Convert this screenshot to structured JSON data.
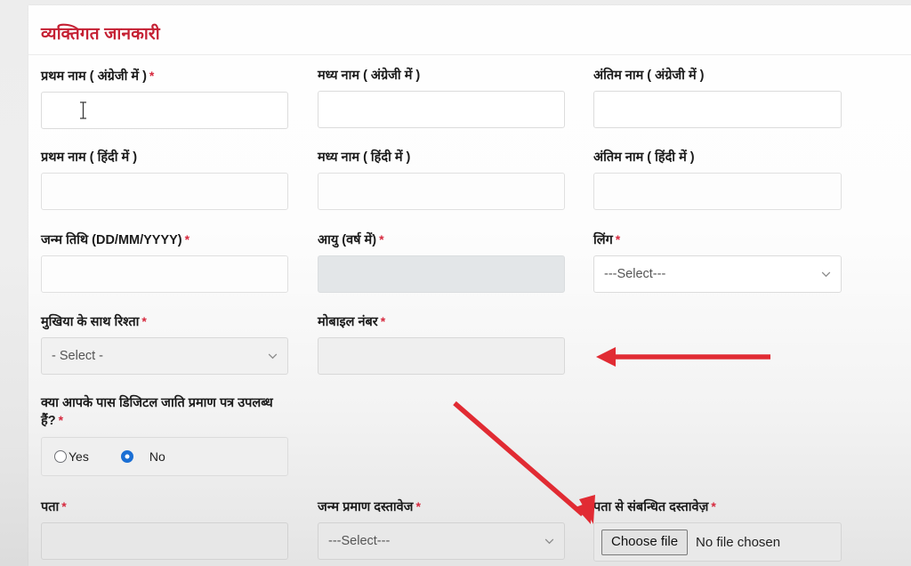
{
  "card": {
    "section_title": "व्यक्तिगत जानकारी",
    "title_color": "#c52033"
  },
  "fields": {
    "first_name_en": {
      "label": "प्रथम नाम ( अंग्रेजी में )",
      "required": true,
      "value": ""
    },
    "middle_name_en": {
      "label": "मध्य नाम ( अंग्रेजी में )",
      "required": false,
      "value": ""
    },
    "last_name_en": {
      "label": "अंतिम नाम ( अंग्रेजी में )",
      "required": false,
      "value": ""
    },
    "first_name_hi": {
      "label": "प्रथम नाम ( हिंदी में )",
      "required": false,
      "value": ""
    },
    "middle_name_hi": {
      "label": "मध्य नाम ( हिंदी में )",
      "required": false,
      "value": ""
    },
    "last_name_hi": {
      "label": "अंतिम नाम ( हिंदी में )",
      "required": false,
      "value": ""
    },
    "dob": {
      "label": "जन्म तिथि (DD/MM/YYYY)",
      "required": true,
      "value": ""
    },
    "age": {
      "label": "आयु (वर्ष में)",
      "required": true,
      "value": "",
      "disabled": true
    },
    "gender": {
      "label": "लिंग",
      "required": true,
      "selected": "---Select---"
    },
    "relation_head": {
      "label": "मुखिया के साथ रिश्ता",
      "required": true,
      "selected": "- Select -"
    },
    "mobile": {
      "label": "मोबाइल नंबर",
      "required": true,
      "value": ""
    },
    "digital_caste": {
      "label": "क्या आपके पास डिजिटल जाति प्रमाण पत्र उपलब्ध हैं?",
      "required": true,
      "options": [
        {
          "label": "Yes",
          "checked": false
        },
        {
          "label": "No",
          "checked": true
        }
      ]
    },
    "address": {
      "label": "पता",
      "required": true,
      "value": ""
    },
    "birth_doc": {
      "label": "जन्म प्रमाण दस्तावेज",
      "required": true,
      "selected": "---Select---"
    },
    "address_doc": {
      "label": "पता से संबन्धित दस्तावेज़",
      "required": true,
      "button_label": "Choose file",
      "status_text": "No file chosen"
    }
  },
  "annotations": {
    "arrow_color": "#e12b33",
    "arrow_mobile": "left-pointing-arrow-at-mobile-number",
    "arrow_file": "diagonal-arrow-to-choose-file"
  }
}
